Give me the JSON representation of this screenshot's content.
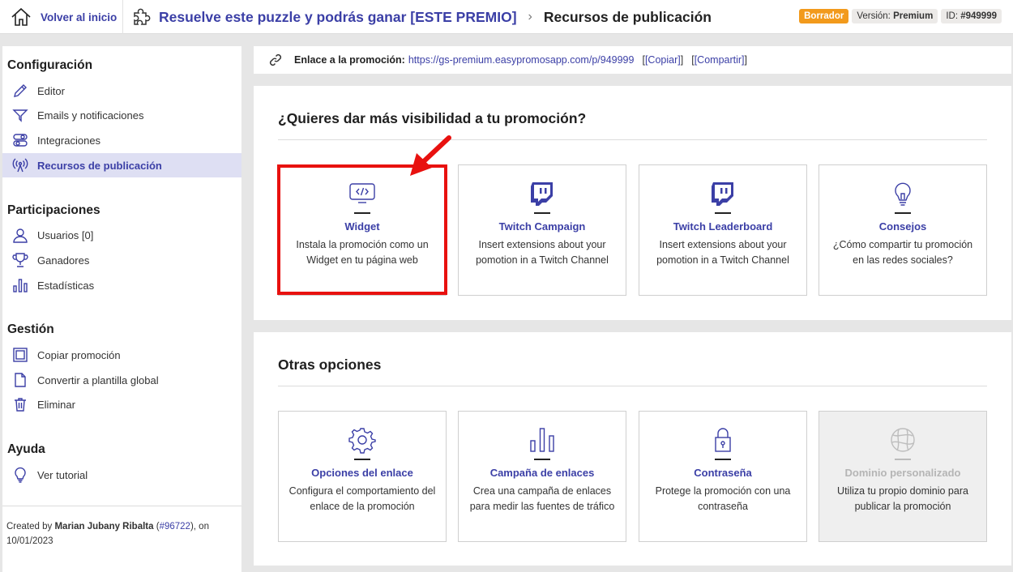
{
  "header": {
    "home_label": "Volver al inicio",
    "promo_title": "Resuelve este puzzle y podrás ganar [ESTE PREMIO]",
    "page_title": "Recursos de publicación",
    "status_badge": "Borrador",
    "version_label": "Versión:",
    "version_value": "Premium",
    "id_label": "ID:",
    "id_value": "#949999"
  },
  "sidebar": {
    "sections": [
      {
        "title": "Configuración",
        "items": [
          {
            "label": "Editor",
            "icon": "pencil-icon"
          },
          {
            "label": "Emails y notificaciones",
            "icon": "funnel-icon"
          },
          {
            "label": "Integraciones",
            "icon": "toggles-icon"
          },
          {
            "label": "Recursos de publicación",
            "icon": "broadcast-icon",
            "active": true
          }
        ]
      },
      {
        "title": "Participaciones",
        "items": [
          {
            "label": "Usuarios [0]",
            "icon": "user-icon"
          },
          {
            "label": "Ganadores",
            "icon": "trophy-icon"
          },
          {
            "label": "Estadísticas",
            "icon": "bar-chart-icon"
          }
        ]
      },
      {
        "title": "Gestión",
        "items": [
          {
            "label": "Copiar promoción",
            "icon": "copy-icon"
          },
          {
            "label": "Convertir a plantilla global",
            "icon": "document-icon"
          },
          {
            "label": "Eliminar",
            "icon": "trash-icon"
          }
        ]
      },
      {
        "title": "Ayuda",
        "items": [
          {
            "label": "Ver tutorial",
            "icon": "lightbulb-icon"
          }
        ]
      }
    ],
    "created": {
      "prefix": "Created by",
      "author": "Marian Jubany Ribalta",
      "open": "(",
      "user_id": "#96722",
      "close": "), on",
      "date": "10/01/2023"
    }
  },
  "link_bar": {
    "label": "Enlace a la promoción:",
    "url": "https://gs-premium.easypromosapp.com/p/949999",
    "copy": "[Copiar]",
    "share": "[Compartir]"
  },
  "visibility": {
    "title": "¿Quieres dar más visibilidad a tu promoción?",
    "cards": [
      {
        "title": "Widget",
        "desc": "Instala la promoción como un Widget en tu página web",
        "icon": "code-monitor-icon"
      },
      {
        "title": "Twitch Campaign",
        "desc": "Insert extensions about your pomotion in a Twitch Channel",
        "icon": "twitch-icon"
      },
      {
        "title": "Twitch Leaderboard",
        "desc": "Insert extensions about your pomotion in a Twitch Channel",
        "icon": "twitch-icon"
      },
      {
        "title": "Consejos",
        "desc": "¿Cómo compartir tu promoción en las redes sociales?",
        "icon": "lightbulb-icon"
      }
    ]
  },
  "other_options": {
    "title": "Otras opciones",
    "cards": [
      {
        "title": "Opciones del enlace",
        "desc": "Configura el comportamiento del enlace de la promoción",
        "icon": "gear-icon"
      },
      {
        "title": "Campaña de enlaces",
        "desc": "Crea una campaña de enlaces para medir las fuentes de tráfico",
        "icon": "bar-chart-icon"
      },
      {
        "title": "Contraseña",
        "desc": "Protege la promoción con una contraseña",
        "icon": "lock-icon"
      },
      {
        "title": "Dominio personalizado",
        "desc": "Utiliza tu propio dominio para publicar la promoción",
        "icon": "globe-icon",
        "disabled": true
      }
    ]
  },
  "colors": {
    "accent": "#3b3fa6",
    "draft_badge": "#f29a1c",
    "highlight": "#e8110f",
    "active_nav_bg": "#dedff3"
  }
}
